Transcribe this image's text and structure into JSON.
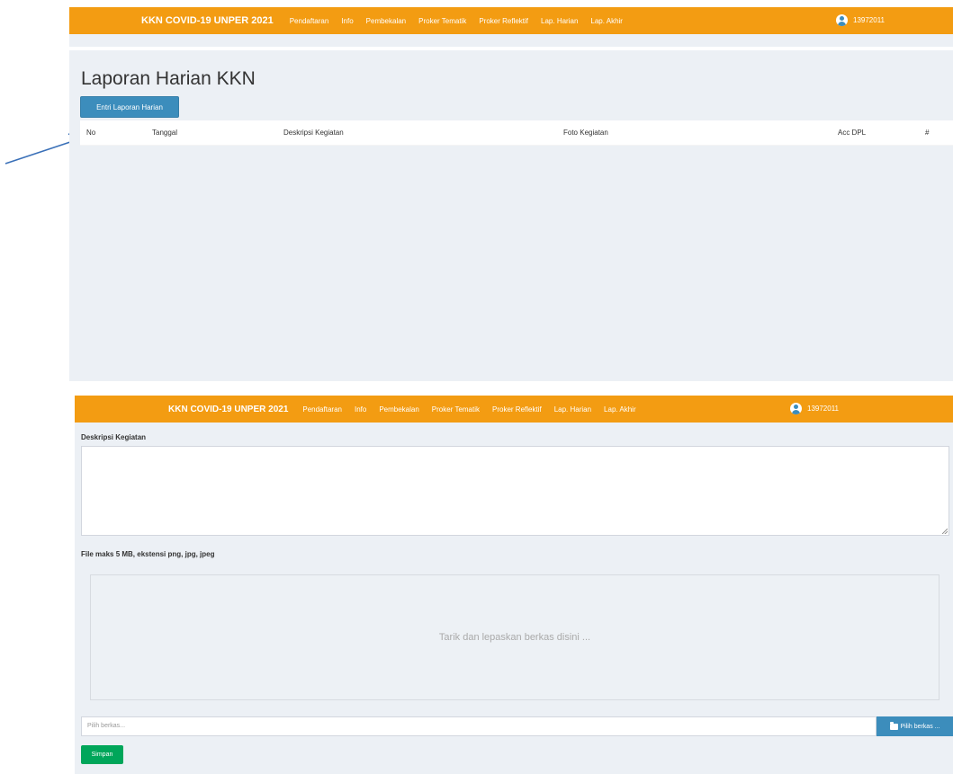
{
  "navbar": {
    "brand": "KKN COVID-19 UNPER 2021",
    "items": [
      "Pendaftaran",
      "Info",
      "Pembekalan",
      "Proker Tematik",
      "Proker Reflektif",
      "Lap. Harian",
      "Lap. Akhir"
    ],
    "user": "13972011"
  },
  "page": {
    "title": "Laporan Harian KKN",
    "add_button": "Entri Laporan Harian"
  },
  "table": {
    "columns": [
      "No",
      "Tanggal",
      "Deskripsi Kegiatan",
      "Foto Kegiatan",
      "Acc DPL",
      "#"
    ]
  },
  "form": {
    "description_label": "Deskripsi Kegiatan",
    "file_label": "File maks 5 MB, ekstensi png, jpg, jpeg",
    "dropzone_text": "Tarik dan lepaskan berkas disini ...",
    "file_placeholder": "Pilih berkas...",
    "browse_button": "Pilih berkas ...",
    "submit_button": "Simpan"
  },
  "colors": {
    "navbar": "#f39c12",
    "primary": "#3c8dbc",
    "success": "#00a65a",
    "background": "#ecf0f5",
    "arrow": "#3a70b8"
  }
}
